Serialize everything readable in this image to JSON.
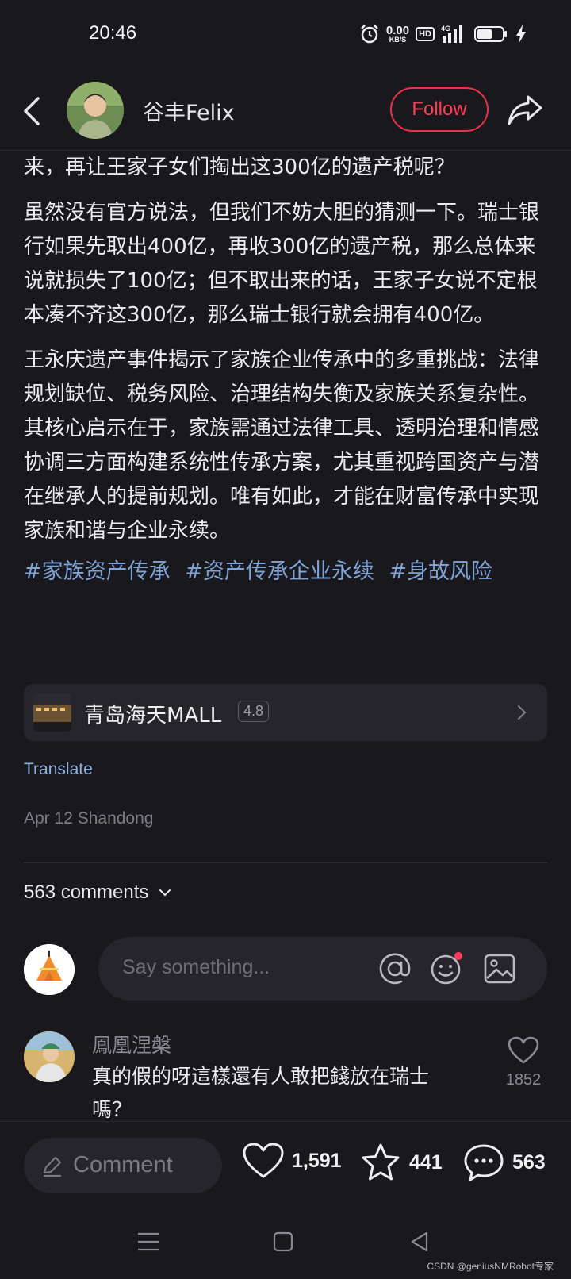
{
  "status_bar": {
    "time": "20:46",
    "net_speed_value": "0.00",
    "net_speed_unit": "KB/S",
    "hd_badge": "HD",
    "network": "4G",
    "icons": [
      "alarm-icon",
      "signal-icon",
      "battery-icon",
      "charging-icon"
    ]
  },
  "header": {
    "author_name": "谷丰Felix",
    "follow_label": "Follow",
    "icons": [
      "back-arrow-icon",
      "share-icon"
    ]
  },
  "article": {
    "paragraphs": [
      "来，再让王家子女们掏出这300亿的遗产税呢？",
      "虽然没有官方说法，但我们不妨大胆的猜测一下。瑞士银行如果先取出400亿，再收300亿的遗产税，那么总体来说就损失了100亿；但不取出来的话，王家子女说不定根本凑不齐这300亿，那么瑞士银行就会拥有400亿。",
      "王永庆遗产事件揭示了家族企业传承中的多重挑战：法律规划缺位、税务风险、治理结构失衡及家族关系复杂性。其核心启示在于，家族需通过法律工具、透明治理和情感协调三方面构建系统性传承方案，尤其重视跨国资产与潜在继承人的提前规划。唯有如此，才能在财富传承中实现家族和谐与企业永续。"
    ],
    "hashtags": [
      "#家族资产传承",
      "#资产传承企业永续",
      "#身故风险"
    ]
  },
  "poi": {
    "name": "青岛海天MALL",
    "rating": "4.8"
  },
  "translate_label": "Translate",
  "post_meta": "Apr 12 Shandong",
  "comments": {
    "count_label": "563 comments",
    "input_placeholder": "Say something...",
    "input_icons": [
      "at-icon",
      "emoji-icon",
      "image-icon"
    ],
    "items": [
      {
        "author": "鳳凰涅槃",
        "text": "真的假的呀這樣還有人敢把錢放在瑞士嗎？",
        "likes": "1852"
      }
    ]
  },
  "bottom_bar": {
    "comment_label": "Comment",
    "likes": "1,591",
    "favorites": "441",
    "comments": "563"
  },
  "watermark": "CSDN @geniusNMRobot专家",
  "colors": {
    "background": "#18181d",
    "accent_red": "#ff3d55",
    "hashtag_blue": "#7fa3d6",
    "link_blue": "#8fb2e2"
  }
}
